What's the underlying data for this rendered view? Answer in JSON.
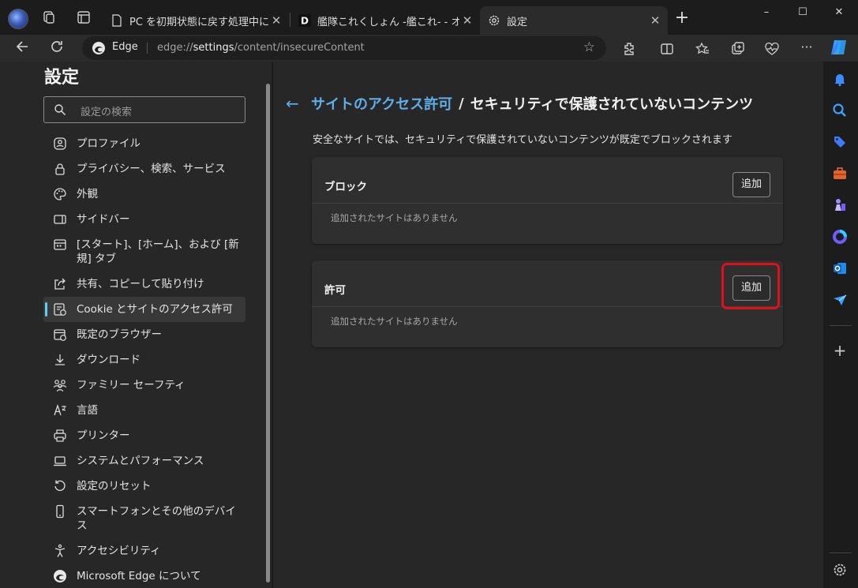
{
  "window": {
    "tabs": [
      {
        "title": "PC を初期状態に戻す処理中に削除",
        "favicon": "page-icon",
        "active": false
      },
      {
        "title": "艦隊これくしょん -艦これ- - オンライン",
        "favicon": "dmm-icon",
        "active": false
      },
      {
        "title": "設定",
        "favicon": "gear-icon",
        "active": true
      }
    ],
    "new_tab": "+",
    "controls": {
      "minimize": "–",
      "maximize": "☐",
      "close": "✕"
    }
  },
  "toolbar": {
    "site_chip": "Edge",
    "url_prefix": "edge://",
    "url_bold": "settings",
    "url_rest": "/content/insecureContent"
  },
  "settings": {
    "title": "設定",
    "search_placeholder": "設定の検索",
    "menu": [
      {
        "label": "プロファイル",
        "icon": "profile-icon"
      },
      {
        "label": "プライバシー、検索、サービス",
        "icon": "lock-icon"
      },
      {
        "label": "外観",
        "icon": "palette-icon"
      },
      {
        "label": "サイドバー",
        "icon": "sidebar-icon"
      },
      {
        "label": "[スタート]、[ホーム]、および [新規] タブ",
        "icon": "home-tab-icon"
      },
      {
        "label": "共有、コピーして貼り付け",
        "icon": "share-icon"
      },
      {
        "label": "Cookie とサイトのアクセス許可",
        "icon": "cookie-icon",
        "active": true
      },
      {
        "label": "既定のブラウザー",
        "icon": "browser-icon"
      },
      {
        "label": "ダウンロード",
        "icon": "download-icon"
      },
      {
        "label": "ファミリー セーフティ",
        "icon": "family-icon"
      },
      {
        "label": "言語",
        "icon": "language-icon"
      },
      {
        "label": "プリンター",
        "icon": "printer-icon"
      },
      {
        "label": "システムとパフォーマンス",
        "icon": "laptop-icon"
      },
      {
        "label": "設定のリセット",
        "icon": "reset-icon"
      },
      {
        "label": "スマートフォンとその他のデバイス",
        "icon": "phone-icon"
      },
      {
        "label": "アクセシビリティ",
        "icon": "accessibility-icon"
      },
      {
        "label": "Microsoft Edge について",
        "icon": "edge-icon"
      }
    ]
  },
  "page": {
    "breadcrumb_link": "サイトのアクセス許可",
    "breadcrumb_sep": "/",
    "breadcrumb_current": "セキュリティで保護されていないコンテンツ",
    "description": "安全なサイトでは、セキュリティで保護されていないコンテンツが既定でブロックされます",
    "block": {
      "title": "ブロック",
      "add_label": "追加",
      "empty": "追加されたサイトはありません"
    },
    "allow": {
      "title": "許可",
      "add_label": "追加",
      "empty": "追加されたサイトはありません"
    }
  },
  "colors": {
    "accent": "#60cdff",
    "link": "#60aee8",
    "highlight": "#e0101a"
  }
}
